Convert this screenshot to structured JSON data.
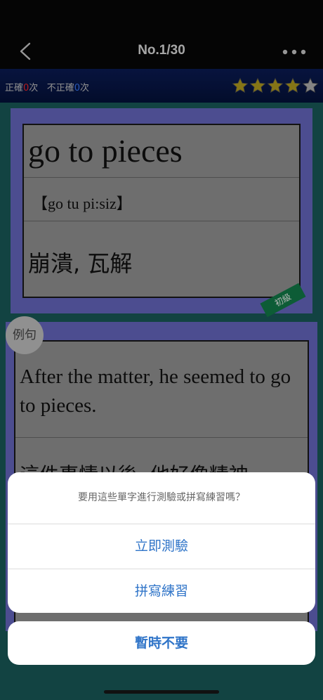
{
  "nav": {
    "title": "No.1/30",
    "back_icon": "chevron-left-icon",
    "more_icon": "ellipsis-icon"
  },
  "stats": {
    "correct_label": "正確",
    "correct_count": "0",
    "times_label": "次",
    "incorrect_label": "不正確",
    "incorrect_count": "0",
    "times_label2": "次"
  },
  "rating": {
    "stars_filled": 4,
    "stars_total": 5,
    "star_color": "#b9a21f"
  },
  "card": {
    "word": "go to pieces",
    "phonetic": "【go tu pi:siz】",
    "meaning": "崩潰, 瓦解",
    "level_badge": "初級"
  },
  "example": {
    "label": "例句",
    "english": "After the matter, he seemed to go to pieces.",
    "chinese": "這件事情以後, 他好像精神"
  },
  "sheet": {
    "prompt": "要用這些單字進行測驗或拼寫練習嗎？",
    "options": [
      "立即測驗",
      "拼寫練習"
    ],
    "cancel": "暫時不要",
    "accent_color": "#2f74c8"
  }
}
